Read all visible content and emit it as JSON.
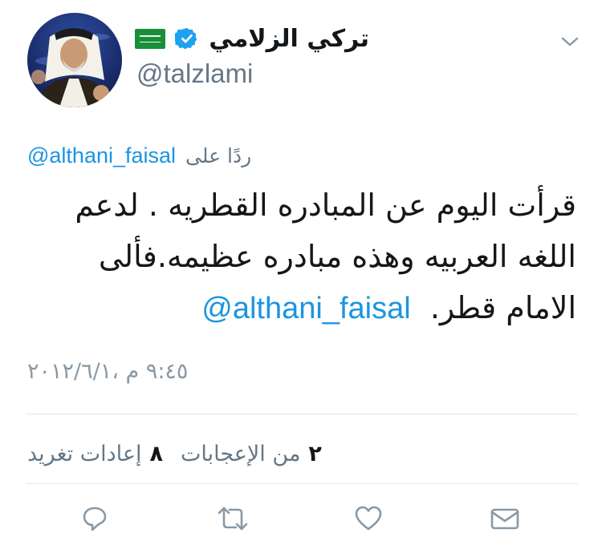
{
  "tweet": {
    "display_name": "تركي الزلامي",
    "handle": "@talzlami",
    "verified": true,
    "flag": "saudi-flag",
    "reply_prefix": "ردًا على",
    "reply_to": "@althani_faisal",
    "body_mention": "@althani_faisal",
    "body_text": "قرأت اليوم عن المبادره القطريه . لدعم اللغه العربيه وهذه مبادره عظيمه.فألى الامام قطر.",
    "timestamp": "٩:٤٥ م ،٢٠١٢/٦/١",
    "stats": {
      "retweets_count": "٨",
      "retweets_label": "إعادات تغريد",
      "likes_count": "٢",
      "likes_label": "من الإعجابات"
    }
  },
  "icons": {
    "menu": "chevron-down-icon",
    "reply": "reply-icon",
    "retweet": "retweet-icon",
    "like": "heart-icon",
    "dm": "envelope-icon"
  },
  "colors": {
    "link": "#1b95e0",
    "muted": "#657786",
    "icon": "#8899a6",
    "divider": "#e1e8ed",
    "verified": "#1da1f2",
    "flag": "#1a8f3a"
  }
}
